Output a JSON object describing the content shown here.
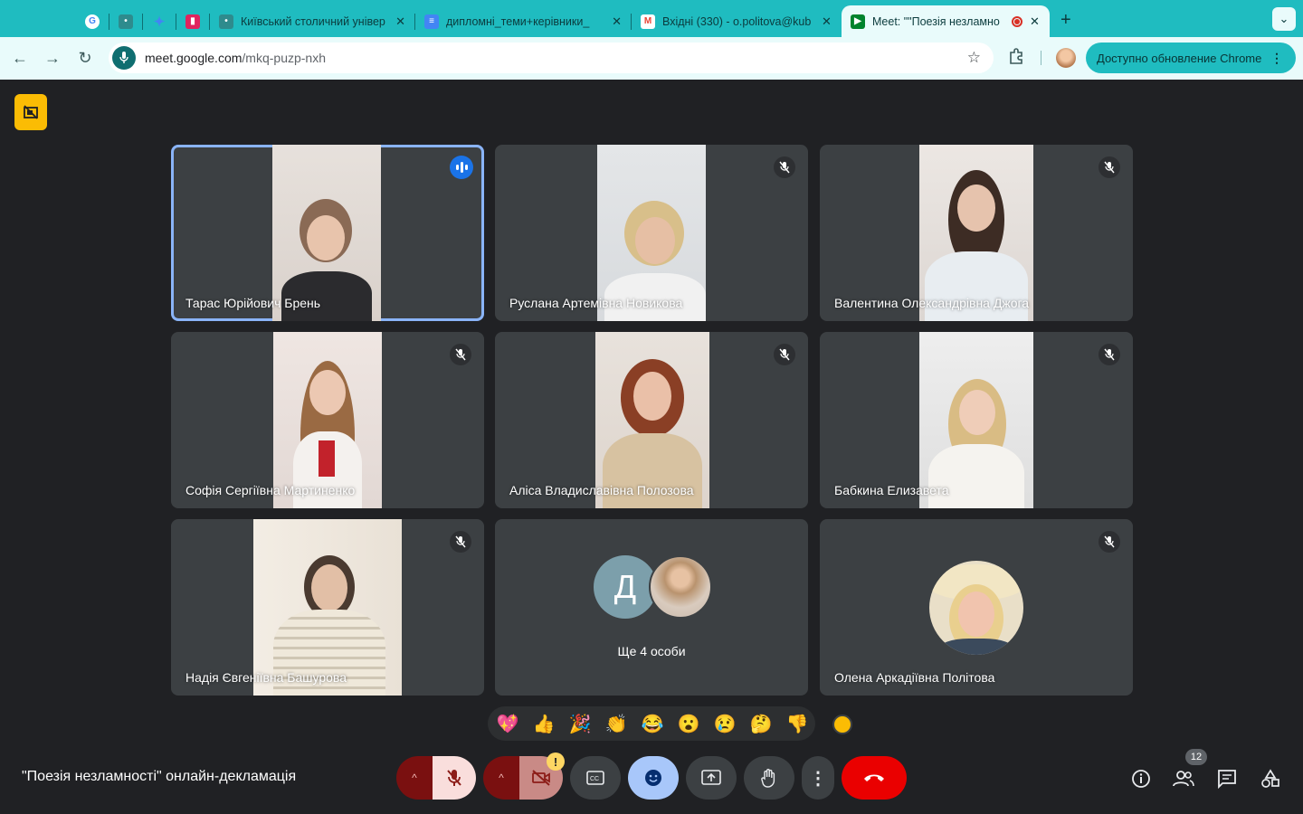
{
  "browser": {
    "tabs": [
      {
        "title": "",
        "favicon": "google-icon",
        "color": "#ffffff"
      },
      {
        "title": "",
        "favicon": "university-icon",
        "color": "#2e8b8d"
      },
      {
        "title": "",
        "favicon": "gemini-icon",
        "color": "#4285f4"
      },
      {
        "title": "",
        "favicon": "pinned-app-icon",
        "color": "#e0245e"
      },
      {
        "title": "Київський столичний універ",
        "favicon": "university-icon",
        "color": "#2e8b8d"
      },
      {
        "title": "дипломні_теми+керівники_",
        "favicon": "docs-icon",
        "color": "#4285f4"
      },
      {
        "title": "Вхідні (330) - o.politova@kub",
        "favicon": "gmail-icon",
        "color": "#ea4335"
      },
      {
        "title": "Meet: \"\"Поезія незламно",
        "favicon": "meet-icon",
        "color": "#00832d",
        "active": true
      }
    ],
    "url_host": "meet.google.com",
    "url_path": "/mkq-puzp-nxh",
    "update_label": "Доступно обновление Chrome"
  },
  "meet": {
    "participants": [
      {
        "name": "Тарас Юрійович Брень",
        "speaking": true
      },
      {
        "name": "Руслана Артемівна Новикова",
        "muted": true
      },
      {
        "name": "Валентина Олександрівна Джога",
        "muted": true
      },
      {
        "name": "Софія Сергіївна Мартиненко",
        "muted": true
      },
      {
        "name": "Аліса Владиславівна Полозова",
        "muted": true
      },
      {
        "name": "Бабкина Елизавета",
        "muted": true
      },
      {
        "name": "Надія Євгеніївна Башурова",
        "muted": true
      },
      {
        "name": "Олена Аркадіївна Політова",
        "muted": true
      }
    ],
    "others": {
      "initial": "Д",
      "label": "Ще 4 особи"
    },
    "reactions": [
      "💖",
      "👍",
      "🎉",
      "👏",
      "😂",
      "😮",
      "😢",
      "🤔",
      "👎"
    ],
    "meeting_title": "\"Поезія незламності\" онлайн-декламація",
    "people_count": "12",
    "warning_glyph": "!"
  },
  "colors": {
    "accent": "#1fbcc0",
    "speaking": "#8ab4f8",
    "end_call": "#ea0000",
    "recording": "#fbbc04"
  }
}
